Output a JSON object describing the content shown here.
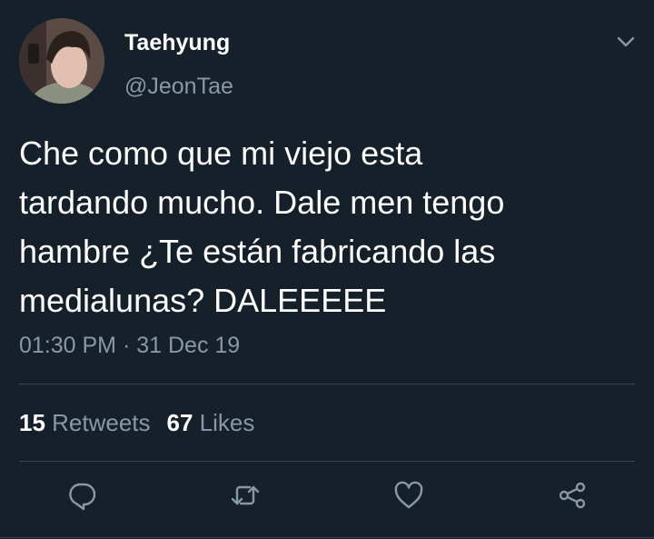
{
  "tweet": {
    "display_name": "Taehyung",
    "handle": "@JeonTae",
    "text": "Che como que mi viejo esta\ntardando mucho. Dale men tengo\nhambre ¿Te están fabricando las\nmedialunas? DALEEEEE",
    "time": "01:30 PM",
    "separator": " · ",
    "date": "31 Dec 19"
  },
  "stats": {
    "retweets_count": "15",
    "retweets_label": " Retweets",
    "likes_count": "67",
    "likes_label": " Likes"
  },
  "actions": [
    {
      "icon": "reply-icon"
    },
    {
      "icon": "retweet-icon"
    },
    {
      "icon": "like-icon"
    },
    {
      "icon": "share-icon"
    }
  ],
  "colors": {
    "background": "#15202b",
    "primary_text": "#ffffff",
    "secondary_text": "#8899a6",
    "divider": "#38444d"
  }
}
